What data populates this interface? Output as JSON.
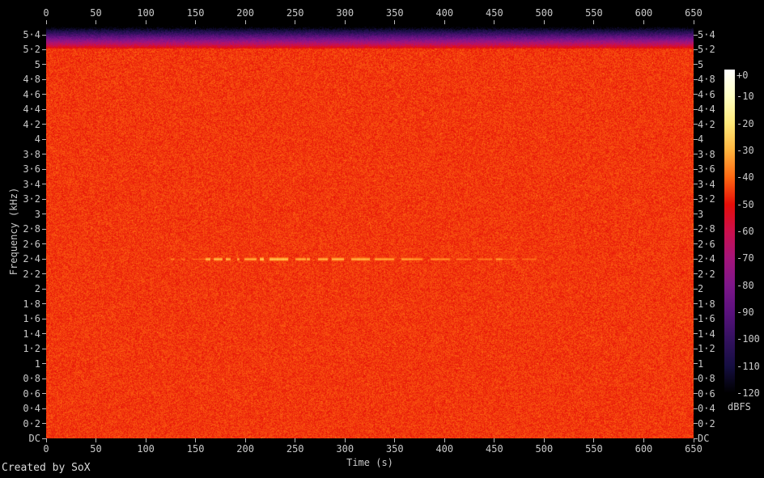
{
  "credit": "Created by SoX",
  "axes": {
    "time": {
      "label": "Time (s)",
      "ticks": [
        "0",
        "50",
        "100",
        "150",
        "200",
        "250",
        "300",
        "350",
        "400",
        "450",
        "500",
        "550",
        "600",
        "650"
      ]
    },
    "freq": {
      "label": "Frequency (kHz)",
      "ticks_top_to_bottom": [
        "5·4",
        "5·2",
        "5",
        "4·8",
        "4·6",
        "4·4",
        "4·2",
        "4",
        "3·8",
        "3·6",
        "3·4",
        "3·2",
        "3",
        "2·8",
        "2·6",
        "2·4",
        "2·2",
        "2",
        "1·8",
        "1·6",
        "1·4",
        "1·2",
        "1",
        "0·8",
        "0·6",
        "0·4",
        "0·2",
        "DC"
      ]
    }
  },
  "colorbar": {
    "unit": "dBFS",
    "labels": [
      "+0",
      "-10",
      "-20",
      "-30",
      "-40",
      "-50",
      "-60",
      "-70",
      "-80",
      "-90",
      "-100",
      "-110",
      "-120"
    ],
    "stops": [
      {
        "pct": 0.0,
        "color": "#ffffff"
      },
      {
        "pct": 8.3,
        "color": "#ffffc2"
      },
      {
        "pct": 16.7,
        "color": "#ffe878"
      },
      {
        "pct": 25.0,
        "color": "#ffb43e"
      },
      {
        "pct": 33.3,
        "color": "#ff6712"
      },
      {
        "pct": 41.7,
        "color": "#e50d08"
      },
      {
        "pct": 50.0,
        "color": "#cb0f4c"
      },
      {
        "pct": 58.3,
        "color": "#a4147a"
      },
      {
        "pct": 66.7,
        "color": "#7d1689"
      },
      {
        "pct": 75.0,
        "color": "#5a117d"
      },
      {
        "pct": 83.3,
        "color": "#33115f"
      },
      {
        "pct": 91.7,
        "color": "#150e41"
      },
      {
        "pct": 100.0,
        "color": "#000000"
      }
    ]
  },
  "colors": {
    "background": "#000000",
    "axis_text": "#c9c9c9",
    "credit_text": "#dcdcdc"
  },
  "chart_data": {
    "type": "heatmap",
    "subtype": "audio-spectrogram",
    "title": "",
    "xlabel": "Time (s)",
    "ylabel": "Frequency (kHz)",
    "x_range_s": [
      0,
      650
    ],
    "x_tick_step_s": 50,
    "y_range_khz": [
      0,
      5.54
    ],
    "y_tick_step_khz": 0.2,
    "y_bottom_label": "DC",
    "colorbar_unit": "dBFS",
    "colorbar_range_db": [
      0,
      -120
    ],
    "grid": false,
    "legend": false,
    "noise_floor_dbfs": [
      -50,
      -42
    ],
    "features": [
      {
        "name": "broadband-noise-floor",
        "freq_khz": [
          0,
          5.15
        ],
        "time_s": [
          0,
          650
        ],
        "level_dbfs": -46,
        "appearance": "uniform orange-red speckled noise filling the plot"
      },
      {
        "name": "highband-rolloff",
        "freq_khz": [
          5.15,
          5.54
        ],
        "time_s": [
          0,
          650
        ],
        "level_dbfs": "-50 down to -120",
        "appearance": "horizontal gradient band at top edge: red to magenta to purple to navy to black"
      },
      {
        "name": "intermittent-tone",
        "freq_khz": 2.4,
        "time_s": [
          125,
          490
        ],
        "level_dbfs": "-38 to -26",
        "appearance": "faint dashed yellow horizontal line",
        "segments": [
          {
            "t": [
              125,
              160
            ],
            "level_dbfs": -37
          },
          {
            "t": [
              160,
              262
            ],
            "level_dbfs": -27
          },
          {
            "t": [
              262,
              330
            ],
            "level_dbfs": -30
          },
          {
            "t": [
              330,
              368
            ],
            "level_dbfs": -28
          },
          {
            "t": [
              368,
              412
            ],
            "level_dbfs": -31
          },
          {
            "t": [
              412,
              458
            ],
            "level_dbfs": -34
          },
          {
            "t": [
              458,
              492
            ],
            "level_dbfs": -37
          }
        ]
      }
    ]
  }
}
